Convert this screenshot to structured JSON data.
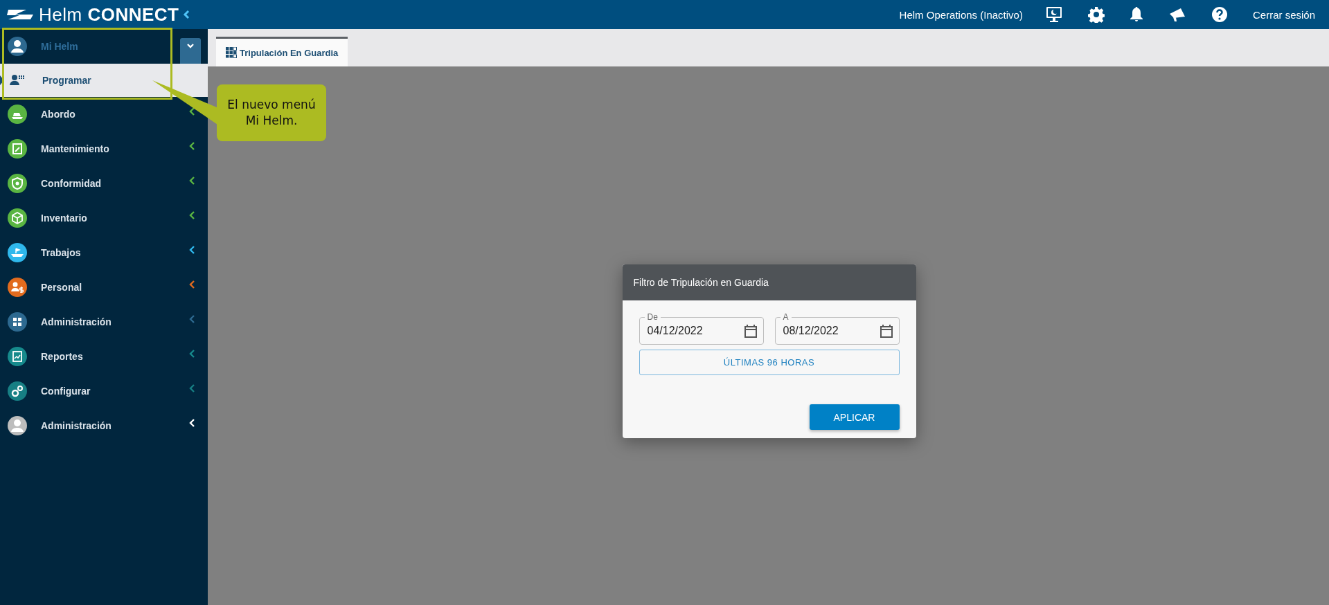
{
  "header": {
    "logo": "Helm **CONNECT**",
    "status": "Helm Operations (Inactivo)",
    "logout": "Cerrar sesión"
  },
  "sidebar": {
    "my_menu": {
      "label": "Mi Helm",
      "expanded": true,
      "items": [
        {
          "label": "Programar",
          "selected": true
        }
      ]
    },
    "items": [
      {
        "label": "Abordo",
        "color": "#5ab542"
      },
      {
        "label": "Mantenimiento",
        "color": "#5ab542"
      },
      {
        "label": "Conformidad",
        "color": "#5ab542"
      },
      {
        "label": "Inventario",
        "color": "#5ab542"
      },
      {
        "label": "Trabajos",
        "color": "#2fb8ec"
      },
      {
        "label": "Personal",
        "color": "#e26b1e"
      },
      {
        "label": "Administración",
        "color": "#2d6990"
      },
      {
        "label": "Reportes",
        "color": "#168a8c"
      },
      {
        "label": "Configurar",
        "color": "#177f84"
      },
      {
        "label": "Administración",
        "color": "#bdbdbd"
      }
    ]
  },
  "tabs": [
    {
      "label": "Tripulación En Guardia",
      "selected": true
    }
  ],
  "callout": {
    "text": "El nuevo menú Mi Helm."
  },
  "dialog": {
    "title": "Filtro de Tripulación en Guardia",
    "fields": [
      {
        "label": "De",
        "value": "04/12/2022"
      },
      {
        "label": "A",
        "value": "08/12/2022"
      }
    ],
    "quick_button": "ÚLTIMAS 96 HORAS",
    "apply_button": "APLICAR"
  }
}
